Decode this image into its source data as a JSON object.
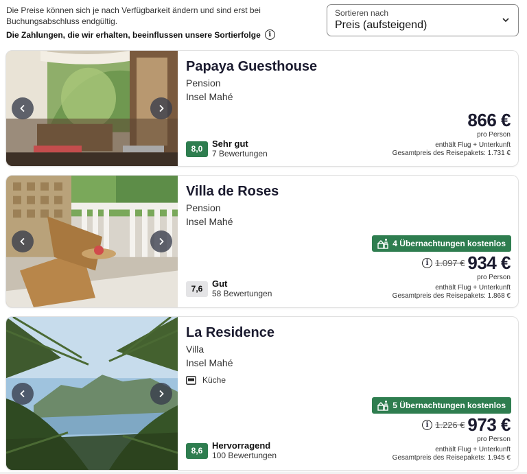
{
  "header": {
    "notice": "Die Preise können sich je nach Verfügbarkeit ändern und sind erst bei Buchungsabschluss endgültig.",
    "sorting_notice": "Die Zahlungen, die wir erhalten, beeinflussen unsere Sortierfolge",
    "info_icon": "info-icon"
  },
  "sort": {
    "label": "Sortieren nach",
    "value": "Preis (aufsteigend)",
    "icon": "chevron-down-icon"
  },
  "colors": {
    "rating_green": "#2e7d4f",
    "deal_green": "#2e7d4f",
    "rating_grey": "#e4e4e6",
    "text_dark": "#1a1a2e"
  },
  "hotels": [
    {
      "name": "Papaya Guesthouse",
      "type": "Pension",
      "location": "Insel Mahé",
      "rating_score": "8,0",
      "rating_label": "Sehr gut",
      "rating_count": "7 Bewertungen",
      "price": "866 €",
      "per_person": "pro Person",
      "includes": "enthält Flug + Unterkunft",
      "total": "Gesamtpreis des Reisepakets: 1.731 €"
    },
    {
      "name": "Villa de Roses",
      "type": "Pension",
      "location": "Insel Mahé",
      "rating_score": "7,6",
      "rating_label": "Gut",
      "rating_count": "58 Bewertungen",
      "deal": "4 Übernachtungen kostenlos",
      "deal_icon": "free-nights-icon",
      "old_price": "1.097 €",
      "price": "934 €",
      "per_person": "pro Person",
      "includes": "enthält Flug + Unterkunft",
      "total": "Gesamtpreis des Reisepakets: 1.868 €"
    },
    {
      "name": "La Residence",
      "type": "Villa",
      "location": "Insel Mahé",
      "amenity": "Küche",
      "amenity_icon": "kitchen-icon",
      "rating_score": "8,6",
      "rating_label": "Hervorragend",
      "rating_count": "100 Bewertungen",
      "deal": "5 Übernachtungen kostenlos",
      "deal_icon": "free-nights-icon",
      "old_price": "1.226 €",
      "price": "973 €",
      "per_person": "pro Person",
      "includes": "enthält Flug + Unterkunft",
      "total": "Gesamtpreis des Reisepakets: 1.945 €"
    }
  ]
}
